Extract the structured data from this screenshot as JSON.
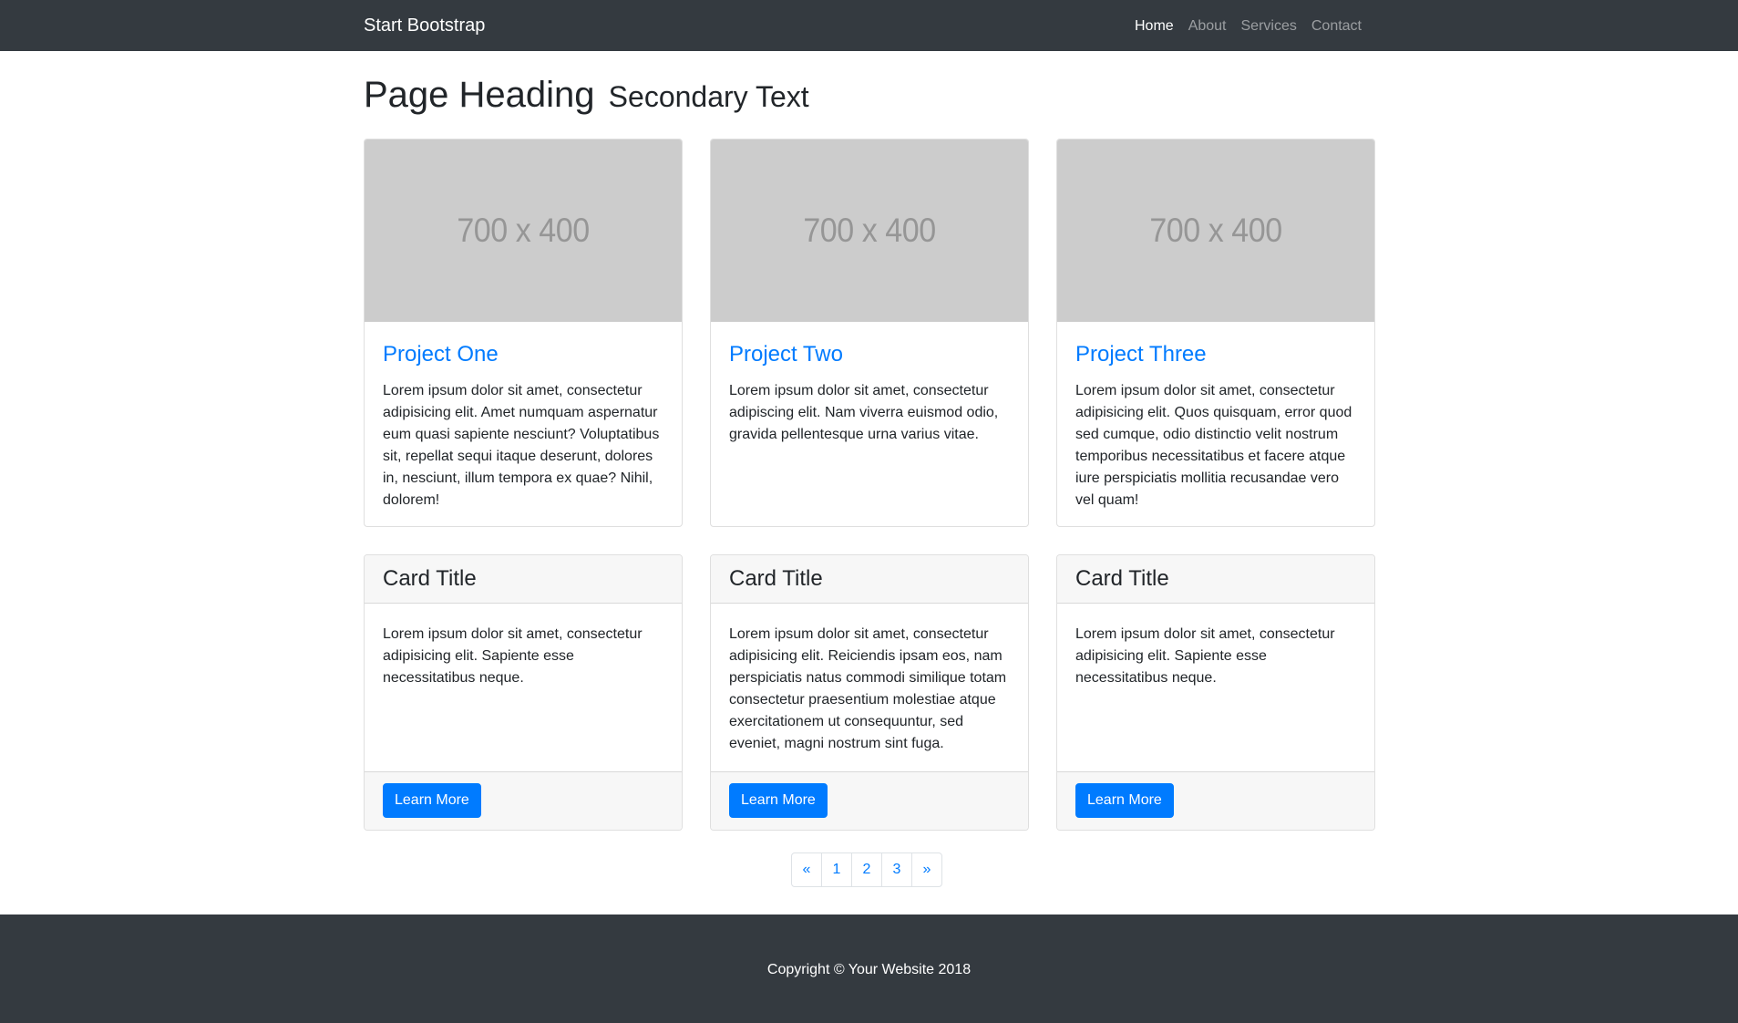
{
  "navbar": {
    "brand": "Start Bootstrap",
    "links": [
      "Home",
      "About",
      "Services",
      "Contact"
    ]
  },
  "page": {
    "heading": "Page Heading",
    "secondary": "Secondary Text"
  },
  "projects": [
    {
      "image_label": "700 x 400",
      "title": "Project One",
      "text": "Lorem ipsum dolor sit amet, consectetur adipisicing elit. Amet numquam aspernatur eum quasi sapiente nesciunt? Voluptatibus sit, repellat sequi itaque deserunt, dolores in, nesciunt, illum tempora ex quae? Nihil, dolorem!"
    },
    {
      "image_label": "700 x 400",
      "title": "Project Two",
      "text": "Lorem ipsum dolor sit amet, consectetur adipiscing elit. Nam viverra euismod odio, gravida pellentesque urna varius vitae."
    },
    {
      "image_label": "700 x 400",
      "title": "Project Three",
      "text": "Lorem ipsum dolor sit amet, consectetur adipisicing elit. Quos quisquam, error quod sed cumque, odio distinctio velit nostrum temporibus necessitatibus et facere atque iure perspiciatis mollitia recusandae vero vel quam!"
    }
  ],
  "cards": [
    {
      "title": "Card Title",
      "text": "Lorem ipsum dolor sit amet, consectetur adipisicing elit. Sapiente esse necessitatibus neque.",
      "button": "Learn More"
    },
    {
      "title": "Card Title",
      "text": "Lorem ipsum dolor sit amet, consectetur adipisicing elit. Reiciendis ipsam eos, nam perspiciatis natus commodi similique totam consectetur praesentium molestiae atque exercitationem ut consequuntur, sed eveniet, magni nostrum sint fuga.",
      "button": "Learn More"
    },
    {
      "title": "Card Title",
      "text": "Lorem ipsum dolor sit amet, consectetur adipisicing elit. Sapiente esse necessitatibus neque.",
      "button": "Learn More"
    }
  ],
  "pagination": [
    "«",
    "1",
    "2",
    "3",
    "»"
  ],
  "footer": {
    "copyright": "Copyright © Your Website 2018"
  },
  "colors": {
    "navbar_bg": "#343a40",
    "link": "#007bff",
    "button": "#007bff",
    "placeholder_bg": "#cccccc"
  }
}
